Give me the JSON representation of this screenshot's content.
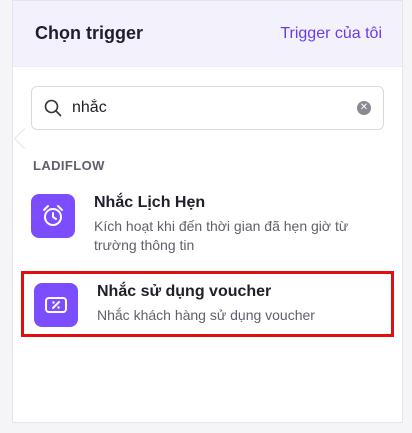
{
  "header": {
    "title": "Chọn trigger",
    "my_triggers_link": "Trigger của tôi"
  },
  "search": {
    "value": "nhắc",
    "icon": "search-icon",
    "clear_icon": "close-icon"
  },
  "section": {
    "label": "LADIFLOW"
  },
  "items": [
    {
      "name": "Nhắc Lịch Hẹn",
      "description": "Kích hoạt khi đến thời gian đã hẹn giờ từ trường thông tin",
      "icon": "alarm-clock-icon"
    },
    {
      "name": "Nhắc sử dụng voucher",
      "description": "Nhắc khách hàng sử dụng voucher",
      "icon": "voucher-icon",
      "highlighted": true
    }
  ],
  "colors": {
    "accent": "#7b4dff",
    "link": "#6b3ce6",
    "highlight_border": "#e01010",
    "header_bg": "#f3f2fc"
  }
}
